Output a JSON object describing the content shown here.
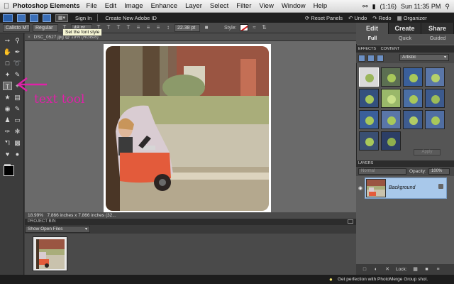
{
  "menubar": {
    "app_name": "Photoshop Elements",
    "items": [
      "File",
      "Edit",
      "Image",
      "Enhance",
      "Layer",
      "Select",
      "Filter",
      "View",
      "Window",
      "Help"
    ],
    "battery": "(1:16)",
    "clock": "Sun 11:35 PM"
  },
  "appbar": {
    "sign_in": "Sign In",
    "create_id": "Create New Adobe ID",
    "reset_panels": "Reset Panels",
    "undo": "Undo",
    "redo": "Redo",
    "organizer": "Organizer"
  },
  "tooltip": "Set the font style",
  "options": {
    "font_family": "Calisto MT",
    "font_style": "Regular",
    "font_size": "48 pt",
    "leading": "22.38 pt",
    "style_label": "Style:"
  },
  "annotation": {
    "label": "text tool"
  },
  "document": {
    "tab_title": "DSC_0527.jpg @ 19% (RGB/8)",
    "status_zoom": "18.99%",
    "status_size": "7.866 inches x 7.866 inches (32..."
  },
  "project_bin": {
    "title": "PROJECT BIN",
    "select_value": "Show Open Files"
  },
  "bottom_tip": "Get perfection with PhotoMerge Group shot.",
  "panel": {
    "modes": [
      "Edit",
      "Create",
      "Share"
    ],
    "submodes": [
      "Full",
      "Quick",
      "Guided"
    ],
    "effects_title": "EFFECTS",
    "content_title": "CONTENT",
    "effects_category": "Artistic",
    "apply_label": "Apply",
    "layers_title": "LAYERS",
    "blend_mode": "Normal",
    "opacity_label": "Opacity:",
    "opacity_value": "100%",
    "layer_name": "Background",
    "lock_label": "Lock:"
  },
  "colors": {
    "annotation": "#e020a8",
    "layer_selected": "#a8c8ea",
    "fx_ball": "#a8c85a",
    "fx_bg": "#3a5f9a"
  }
}
